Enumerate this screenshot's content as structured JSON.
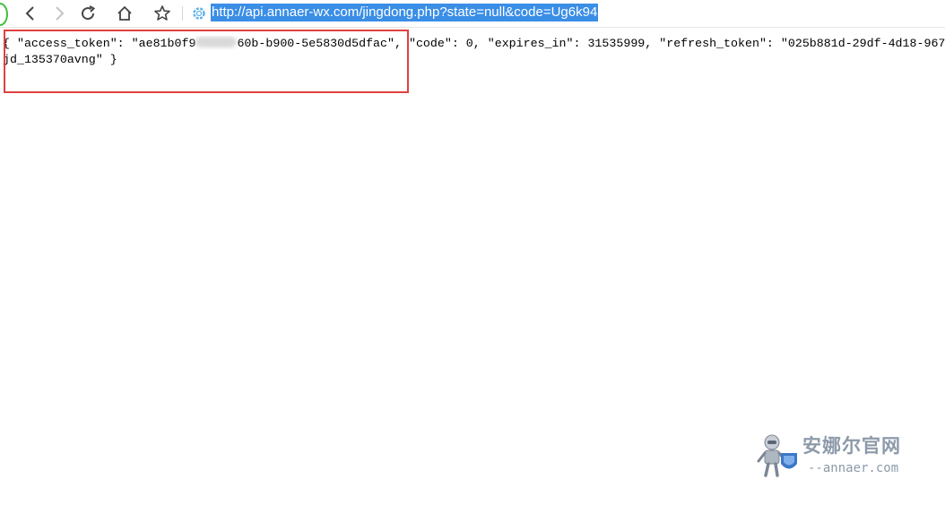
{
  "browser": {
    "back_icon": "chevron-left-icon",
    "forward_icon": "chevron-right-icon",
    "reload_icon": "reload-icon",
    "home_icon": "home-icon",
    "bookmark_icon": "star-icon",
    "site_icon": "gear-icon",
    "url": "http://api.annaer-wx.com/jingdong.php?state=null&code=Ug6k94",
    "url_highlight_color": "#3a8ee6"
  },
  "response": {
    "line1_before_redaction": "{ \"access_token\": \"ae81b0f9",
    "line1_after_redaction": "60b-b900-5e5830d5dfac\", \"code\": 0, \"expires_in\": 31535999, \"refresh_token\": \"025b881d-29df-4d18-967",
    "line2": "jd_135370avng\" }"
  },
  "annotation": {
    "box_color": "#e0413f"
  },
  "watermark": {
    "title": "安娜尔官网",
    "domain": "--annaer.com"
  }
}
